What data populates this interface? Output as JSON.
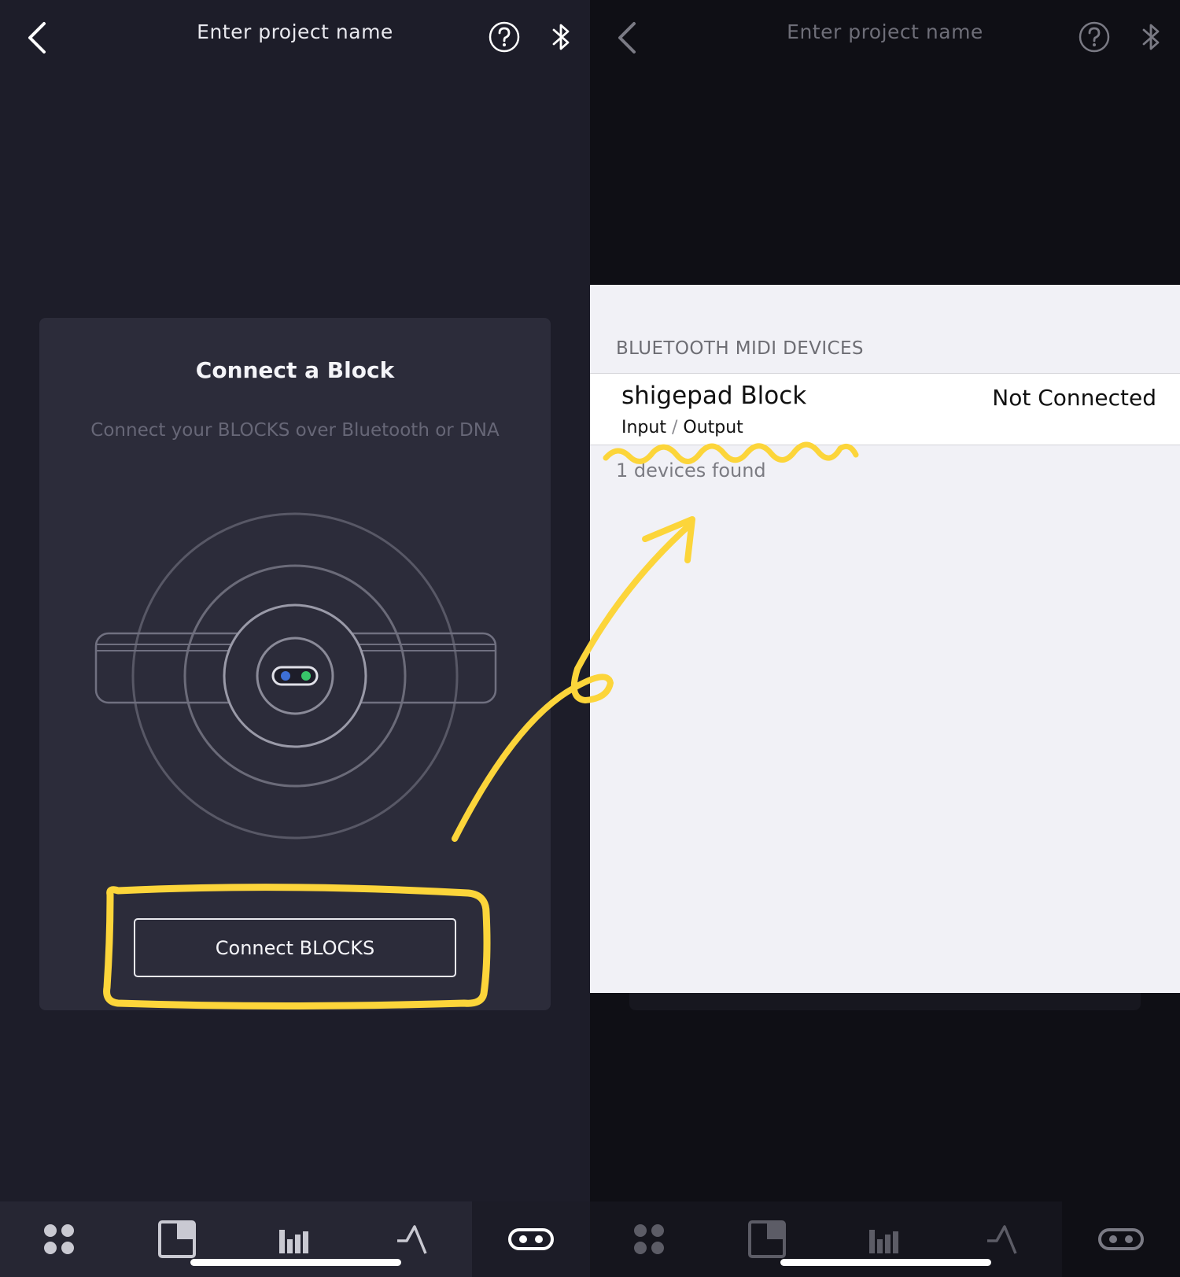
{
  "left_screen": {
    "header": {
      "title": "Enter project name"
    },
    "card": {
      "title": "Connect a Block",
      "subtitle": "Connect your BLOCKS over Bluetooth or DNA",
      "button_label": "Connect BLOCKS"
    },
    "tabs": [
      {
        "icon": "grid-dots-icon"
      },
      {
        "icon": "square-panel-icon"
      },
      {
        "icon": "bar-chart-icon"
      },
      {
        "icon": "envelope-wave-icon"
      },
      {
        "icon": "block-device-icon",
        "active": true
      }
    ]
  },
  "right_screen": {
    "header": {
      "title": "Enter project name"
    },
    "bluetooth_sheet": {
      "section_header": "BLUETOOTH MIDI DEVICES",
      "devices": [
        {
          "name": "shigepad Block",
          "input": "Input",
          "separator": "/",
          "output": "Output",
          "status": "Not Connected"
        }
      ],
      "devices_found": "1 devices found"
    }
  },
  "colors": {
    "annotation": "#fcd53a",
    "dark_background": "#1d1d29",
    "card": "#2c2c3a",
    "sheet": "#f1f1f6"
  }
}
